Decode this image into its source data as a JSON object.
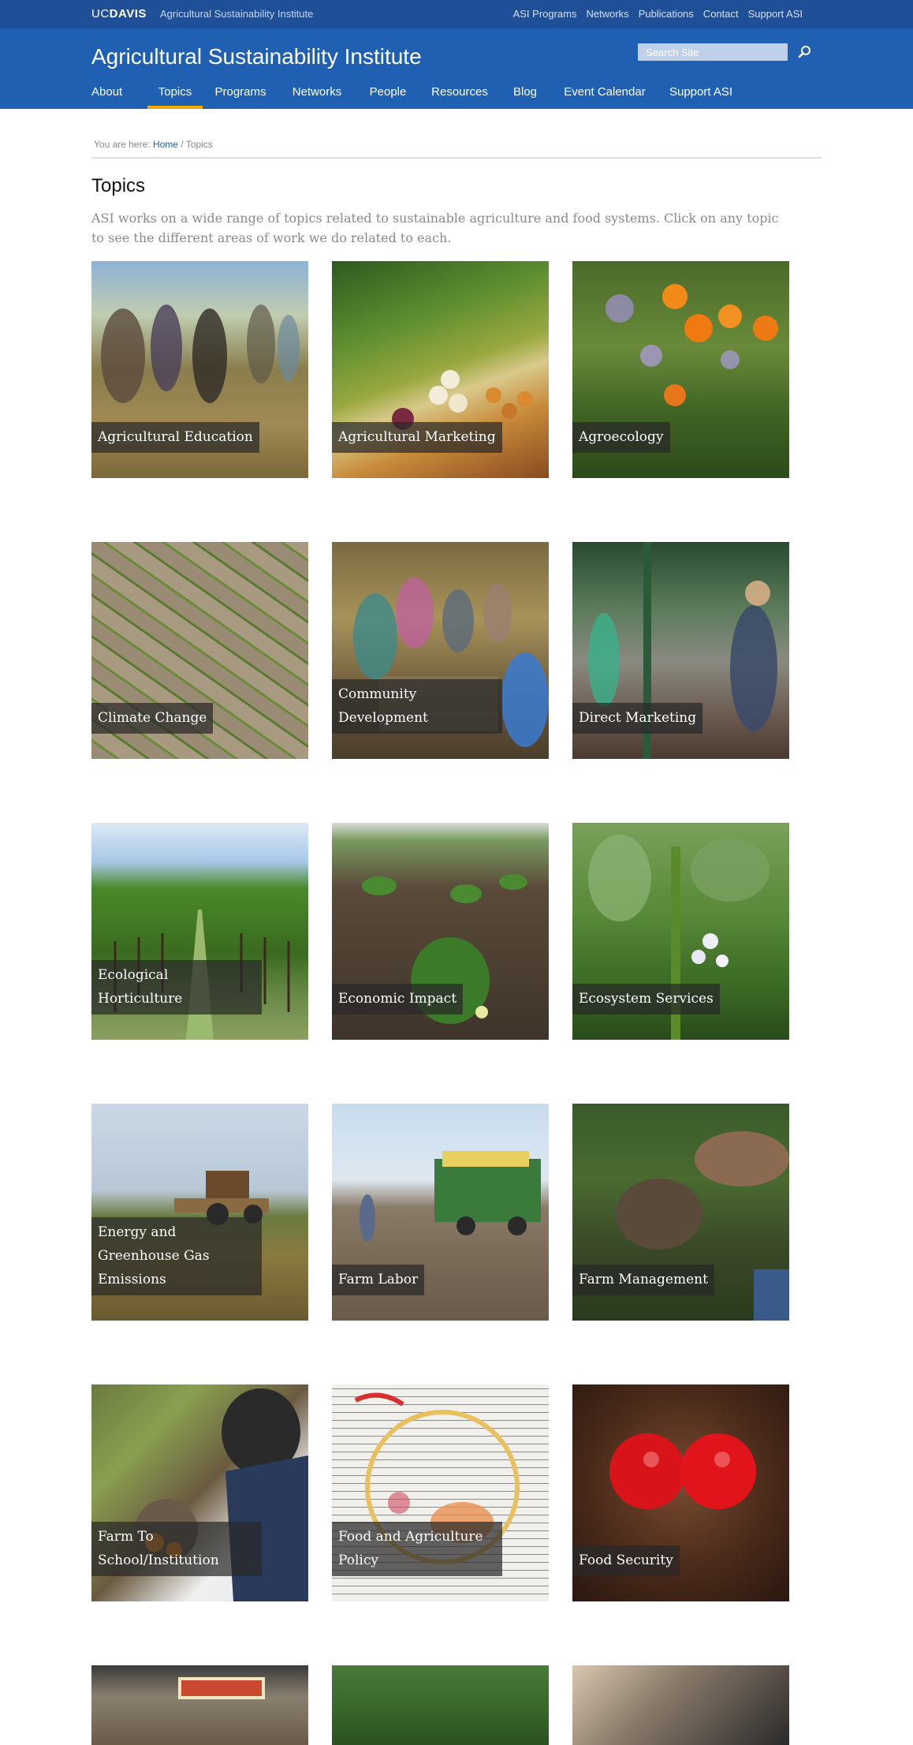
{
  "topbar": {
    "brand_uc": "UC",
    "brand_davis": "DAVIS",
    "site_name": "Agricultural Sustainability Institute",
    "links": [
      "ASI Programs",
      "Networks",
      "Publications",
      "Contact",
      "Support ASI"
    ]
  },
  "header": {
    "title": "Agricultural Sustainability Institute",
    "search_placeholder": "Search Site"
  },
  "nav": {
    "items": [
      "About",
      "Topics",
      "Programs",
      "Networks",
      "People",
      "Resources",
      "Blog",
      "Event Calendar",
      "Support ASI"
    ],
    "active": "Topics"
  },
  "breadcrumb": {
    "prefix": "You are here:",
    "home": "Home",
    "separator": "/",
    "current": "Topics"
  },
  "page": {
    "title": "Topics",
    "intro": "ASI works on a wide range of topics related to sustainable agriculture and food systems. Click on any topic to see the different areas of work we do related to each."
  },
  "topics": [
    "Agricultural Education",
    "Agricultural Marketing",
    "Agroecology",
    "Climate Change",
    "Community Development",
    "Direct Marketing",
    "Ecological Horticulture",
    "Economic Impact",
    "Ecosystem Services",
    "Energy and Greenhouse Gas Emissions",
    "Farm Labor",
    "Farm Management",
    "Farm To School/Institution",
    "Food and Agriculture Policy",
    "Food Security"
  ]
}
